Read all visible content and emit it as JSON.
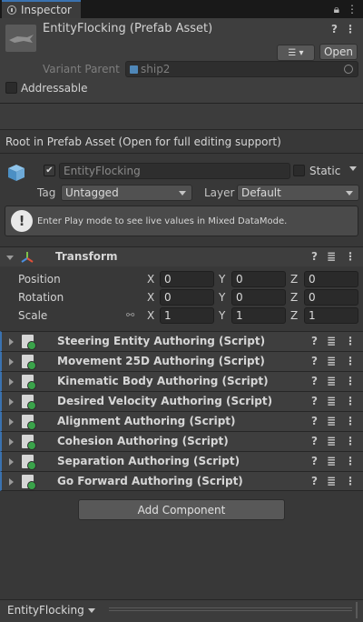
{
  "tab": {
    "label": "Inspector"
  },
  "header": {
    "title": "EntityFlocking (Prefab Asset)",
    "open_label": "Open",
    "variant_parent_label": "Variant Parent",
    "variant_parent_value": "ship2",
    "addressable_label": "Addressable",
    "addressable_checked": false
  },
  "root_note": "Root in Prefab Asset (Open for full editing support)",
  "gameobject": {
    "active": true,
    "name": "EntityFlocking",
    "static_label": "Static",
    "static_checked": false,
    "tag_label": "Tag",
    "tag_value": "Untagged",
    "layer_label": "Layer",
    "layer_value": "Default"
  },
  "help_text": "Enter Play mode to see live values in Mixed DataMode.",
  "transform": {
    "label": "Transform",
    "rows": [
      {
        "label": "Position",
        "x": "0",
        "y": "0",
        "z": "0"
      },
      {
        "label": "Rotation",
        "x": "0",
        "y": "0",
        "z": "0"
      },
      {
        "label": "Scale",
        "x": "1",
        "y": "1",
        "z": "1"
      }
    ],
    "axes": {
      "x": "X",
      "y": "Y",
      "z": "Z"
    }
  },
  "components": [
    "Steering Entity Authoring (Script)",
    "Movement 25D Authoring (Script)",
    "Kinematic Body Authoring (Script)",
    "Desired Velocity Authoring (Script)",
    "Alignment Authoring (Script)",
    "Cohesion Authoring (Script)",
    "Separation Authoring (Script)",
    "Go Forward Authoring (Script)"
  ],
  "add_component_label": "Add Component",
  "footer": {
    "selection_label": "EntityFlocking"
  },
  "icons": {
    "lock": "lock-icon",
    "more": "more-vert-icon",
    "help": "help-icon",
    "presets": "presets-icon"
  }
}
